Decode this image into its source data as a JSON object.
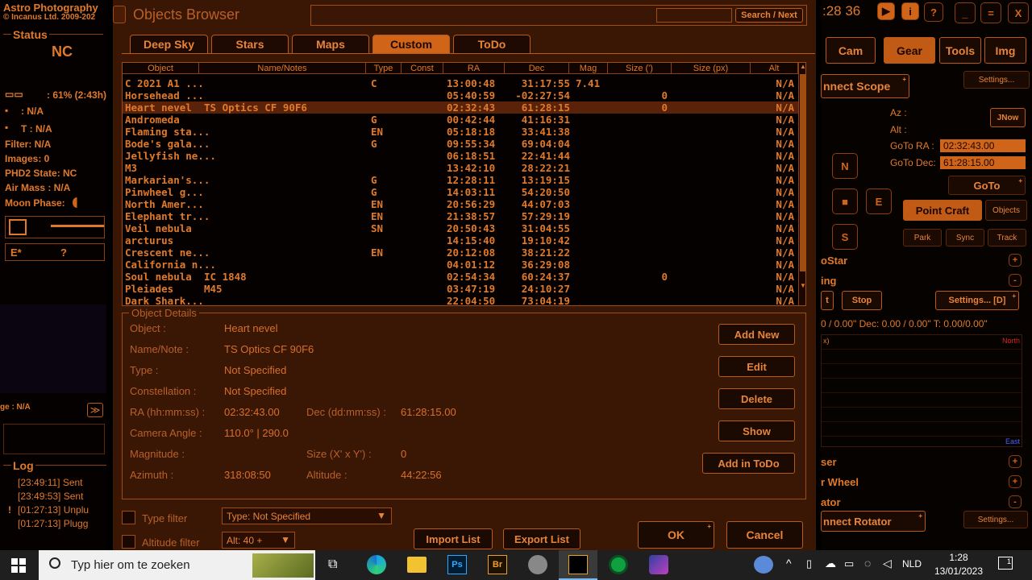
{
  "left": {
    "app_title": "Astro Photography",
    "copyright": "© Incanus Ltd. 2009-202",
    "status_title": "Status",
    "status_value": "NC",
    "battery": ": 61% (2:43h)",
    "focus": ": N/A",
    "temp": "T : N/A",
    "filter": "Filter: N/A",
    "images": "Images: 0",
    "phd2": "PHD2 State: NC",
    "airmass": "Air Mass : N/A",
    "moon": "Moon Phase:",
    "estar": "E*",
    "question": "?",
    "age": "ge : N/A",
    "log_title": "Log",
    "logs": [
      "[23:49:11] Sent",
      "[23:49:53] Sent",
      "[01:27:13] Unplu",
      "[01:27:13] Plugg"
    ],
    "log_mark": "!"
  },
  "browser": {
    "title": "Objects Browser",
    "search_button": "Search / Next",
    "search_value": "",
    "tabs": [
      "Deep Sky",
      "Stars",
      "Maps",
      "Custom",
      "ToDo"
    ],
    "columns": [
      "Object",
      "Name/Notes",
      "Type",
      "Const",
      "RA",
      "Dec",
      "Mag",
      "Size (')",
      "Size (px)",
      "Alt"
    ],
    "rows": [
      [
        "C 2021 A1 ...",
        "",
        "C",
        "",
        "13:00:48",
        "31:17:55",
        "7.41",
        "",
        "",
        "N/A"
      ],
      [
        "Horsehead ...",
        "",
        "",
        "",
        "05:40:59",
        "-02:27:54",
        "",
        "0",
        "",
        "N/A"
      ],
      [
        "Heart nevel",
        "TS Optics CF 90F6",
        "",
        "",
        "02:32:43",
        "61:28:15",
        "",
        "0",
        "",
        "N/A"
      ],
      [
        "Andromeda",
        "",
        "G",
        "",
        "00:42:44",
        "41:16:31",
        "",
        "",
        "",
        "N/A"
      ],
      [
        "Flaming sta...",
        "",
        "EN",
        "",
        "05:18:18",
        "33:41:38",
        "",
        "",
        "",
        "N/A"
      ],
      [
        "Bode's gala...",
        "",
        "G",
        "",
        "09:55:34",
        "69:04:04",
        "",
        "",
        "",
        "N/A"
      ],
      [
        "Jellyfish ne...",
        "",
        "",
        "",
        "06:18:51",
        "22:41:44",
        "",
        "",
        "",
        "N/A"
      ],
      [
        "M3",
        "",
        "",
        "",
        "13:42:10",
        "28:22:21",
        "",
        "",
        "",
        "N/A"
      ],
      [
        "Markarian's...",
        "",
        "G",
        "",
        "12:28:11",
        "13:19:15",
        "",
        "",
        "",
        "N/A"
      ],
      [
        "Pinwheel g...",
        "",
        "G",
        "",
        "14:03:11",
        "54:20:50",
        "",
        "",
        "",
        "N/A"
      ],
      [
        "North Amer...",
        "",
        "EN",
        "",
        "20:56:29",
        "44:07:03",
        "",
        "",
        "",
        "N/A"
      ],
      [
        "Elephant tr...",
        "",
        "EN",
        "",
        "21:38:57",
        "57:29:19",
        "",
        "",
        "",
        "N/A"
      ],
      [
        "Veil nebula",
        "",
        "SN",
        "",
        "20:50:43",
        "31:04:55",
        "",
        "",
        "",
        "N/A"
      ],
      [
        "arcturus",
        "",
        "",
        "",
        "14:15:40",
        "19:10:42",
        "",
        "",
        "",
        "N/A"
      ],
      [
        "Crescent ne...",
        "",
        "EN",
        "",
        "20:12:08",
        "38:21:22",
        "",
        "",
        "",
        "N/A"
      ],
      [
        "California n...",
        "",
        "",
        "",
        "04:01:12",
        "36:29:08",
        "",
        "",
        "",
        "N/A"
      ],
      [
        "Soul nebula",
        "IC 1848",
        "",
        "",
        "02:54:34",
        "60:24:37",
        "",
        "0",
        "",
        "N/A"
      ],
      [
        "Pleiades",
        "M45",
        "",
        "",
        "03:47:19",
        "24:10:27",
        "",
        "",
        "",
        "N/A"
      ],
      [
        "Dark Shark...",
        "",
        "",
        "",
        "22:04:50",
        "73:04:19",
        "",
        "",
        "",
        "N/A"
      ]
    ],
    "details_title": "Object Details",
    "details": {
      "object_label": "Object :",
      "object": "Heart nevel",
      "name_label": "Name/Note :",
      "name": "TS Optics CF 90F6",
      "type_label": "Type :",
      "type": "Not Specified",
      "const_label": "Constellation :",
      "const": "Not Specified",
      "ra_label": "RA (hh:mm:ss) :",
      "ra": "02:32:43.00",
      "dec_label": "Dec (dd:mm:ss) :",
      "dec": "61:28:15.00",
      "angle_label": "Camera Angle :",
      "angle": "110.0° | 290.0",
      "mag_label": "Magnitude :",
      "size_label": "Size (X' x Y') :",
      "size": "0",
      "az_label": "Azimuth :",
      "az": "318:08:50",
      "alt_label": "Altitude :",
      "alt": "44:22:56"
    },
    "buttons": {
      "add_new": "Add New",
      "edit": "Edit",
      "delete": "Delete",
      "show": "Show",
      "add_todo": "Add in ToDo",
      "import": "Import List",
      "export": "Export List",
      "ok": "OK",
      "cancel": "Cancel"
    },
    "type_filter_label": "Type filter",
    "type_filter_value": "Type: Not Specified",
    "alt_filter_label": "Altitude filter",
    "alt_filter_value": "Alt: 40 +"
  },
  "right": {
    "clock": ":28 36",
    "tabs": [
      "Cam",
      "Gear",
      "Tools",
      "Img"
    ],
    "connect_scope": "nnect Scope",
    "settings": "Settings...",
    "az": "Az :",
    "alt": "Alt :",
    "jnow": "JNow",
    "goto_ra_label": "GoTo RA :",
    "goto_ra": "02:32:43.00",
    "goto_dec_label": "GoTo Dec:",
    "goto_dec": "61:28:15.00",
    "n": "N",
    "e": "E",
    "s": "S",
    "stop_sym": "■",
    "goto": "GoTo",
    "point_craft": "Point Craft",
    "objects": "Objects",
    "park": "Park",
    "sync": "Sync",
    "track": "Track",
    "phd": "oStar",
    "guiding": "ing",
    "t_btn": "t",
    "stop": "Stop",
    "settings_d": "Settings... [D]",
    "radec": "0 / 0.00\"  Dec: 0.00 / 0.00\"  T: 0.00/0.00\"",
    "x": "x)",
    "north": "North",
    "east": "East",
    "laser": "ser",
    "filter_wheel": "r Wheel",
    "rotator": "ator",
    "connect_rotator": "nnect Rotator",
    "settings2": "Settings..."
  },
  "taskbar": {
    "search": "Typ hier om te zoeken",
    "lang": "NLD",
    "time": "1:28",
    "date": "13/01/2023",
    "notif": "1"
  }
}
